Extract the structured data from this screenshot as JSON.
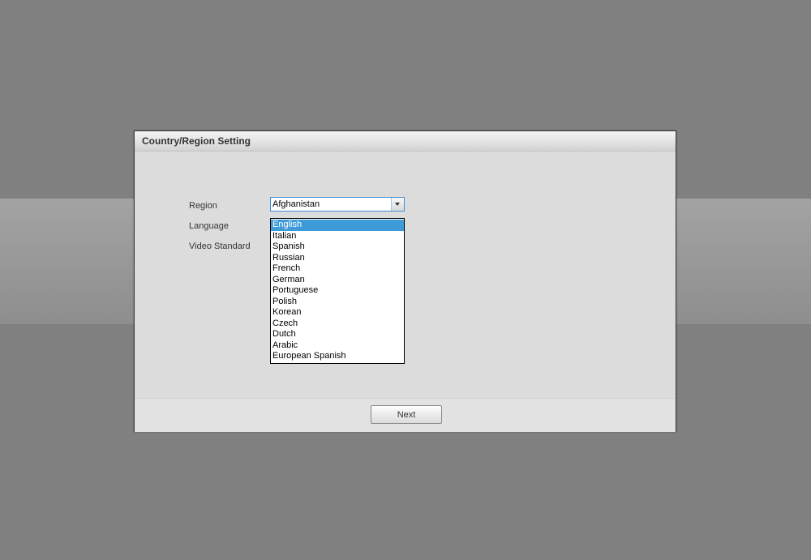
{
  "dialog": {
    "title": "Country/Region Setting"
  },
  "form": {
    "region_label": "Region",
    "language_label": "Language",
    "video_standard_label": "Video Standard",
    "region_value": "Afghanistan"
  },
  "language_dropdown": {
    "selected": "English",
    "options": [
      "English",
      "Italian",
      "Spanish",
      "Russian",
      "French",
      "German",
      "Portuguese",
      "Polish",
      "Korean",
      "Czech",
      "Dutch",
      "Arabic",
      "European Spanish"
    ]
  },
  "footer": {
    "next_label": "Next"
  },
  "colors": {
    "selection_highlight": "#3d9bd9",
    "focus_border": "#3c8fd6",
    "backdrop": "#808080"
  }
}
